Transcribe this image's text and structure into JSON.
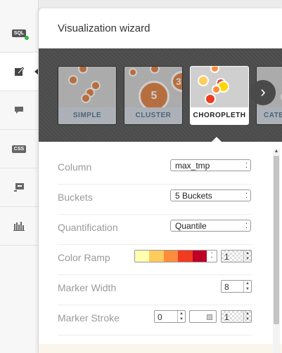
{
  "sidebar": {
    "items": [
      {
        "name": "sql-icon",
        "text": "SQL"
      },
      {
        "name": "wizard-icon",
        "text": ""
      },
      {
        "name": "infowindow-icon",
        "text": ""
      },
      {
        "name": "css-icon",
        "text": "CSS"
      },
      {
        "name": "legend-icon",
        "text": ""
      },
      {
        "name": "chart-icon",
        "text": ""
      }
    ]
  },
  "panel": {
    "title": "Visualization wizard"
  },
  "map_types": {
    "cards": [
      {
        "label": "SIMPLE",
        "selected": false
      },
      {
        "label": "CLUSTER",
        "selected": false,
        "badge_a": "5",
        "badge_b": "3"
      },
      {
        "label": "CHOROPLETH",
        "selected": true
      },
      {
        "label": "CATE",
        "selected": false
      }
    ],
    "next_glyph": "›"
  },
  "form": {
    "column": {
      "label": "Column",
      "value": "max_tmp"
    },
    "buckets": {
      "label": "Buckets",
      "value": "5 Buckets"
    },
    "quantification": {
      "label": "Quantification",
      "value": "Quantile"
    },
    "color_ramp": {
      "label": "Color Ramp",
      "opacity": "1",
      "colors": [
        "#ffffb2",
        "#fecc5c",
        "#fd8d3c",
        "#f03b20",
        "#bd0026"
      ]
    },
    "marker_width": {
      "label": "Marker Width",
      "value": "8"
    },
    "marker_stroke": {
      "label": "Marker Stroke",
      "width": "0",
      "opacity": "1"
    },
    "caret": "⁚"
  },
  "colors": {
    "accent": "#4d6d8a",
    "sql_badge": "#3ab54a"
  }
}
